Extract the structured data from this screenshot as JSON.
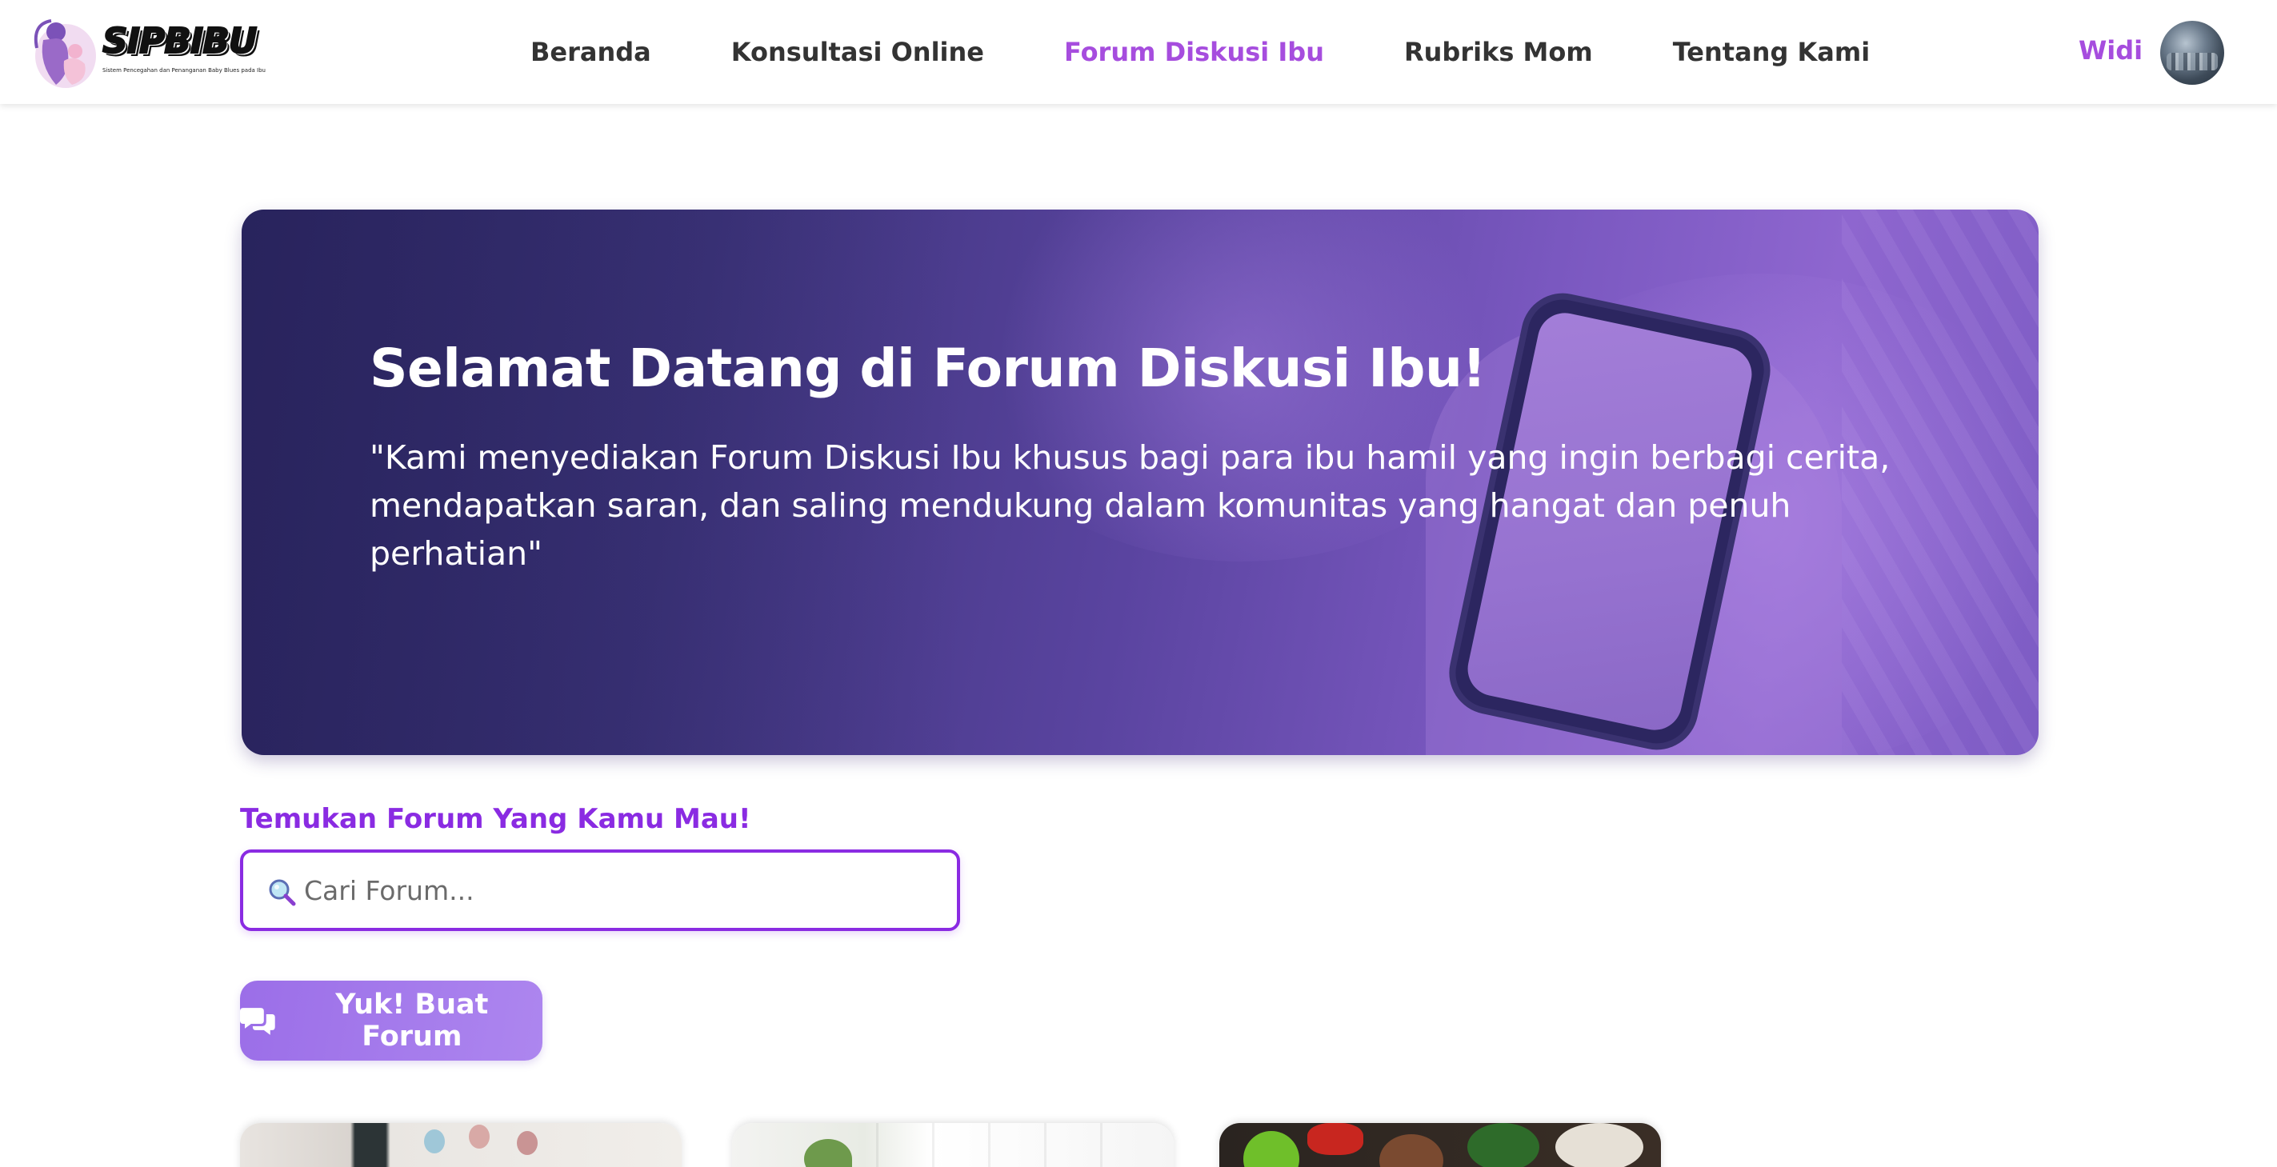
{
  "nav": {
    "brand": "SIPBIBU",
    "tagline": "Sistem Pencegahan dan Penanganan Baby Blues pada Ibu",
    "links": [
      {
        "label": "Beranda"
      },
      {
        "label": "Konsultasi Online"
      },
      {
        "label": "Forum Diskusi Ibu"
      },
      {
        "label": "Rubriks Mom"
      },
      {
        "label": "Tentang Kami"
      }
    ],
    "active_link": "Forum Diskusi Ibu",
    "user_name": "Widi"
  },
  "hero": {
    "title": "Selamat Datang di Forum Diskusi Ibu!",
    "text": "\"Kami menyediakan Forum Diskusi Ibu khusus bagi para ibu hamil yang ingin berbagi cerita, mendapatkan saran, dan saling mendukung dalam komunitas yang hangat dan penuh perhatian\""
  },
  "search": {
    "label": "Temukan Forum Yang Kamu Mau!",
    "placeholder": "Cari Forum...",
    "value": ""
  },
  "actions": {
    "create_forum_label": "Yuk! Buat Forum"
  },
  "colors": {
    "accent": "#a64dde",
    "search_border": "#8a2be2",
    "button": "#9b6ee8",
    "hero_overlay": "#3d347b"
  },
  "icons": {
    "search": "search-icon",
    "chat": "chat-bubbles-icon"
  }
}
